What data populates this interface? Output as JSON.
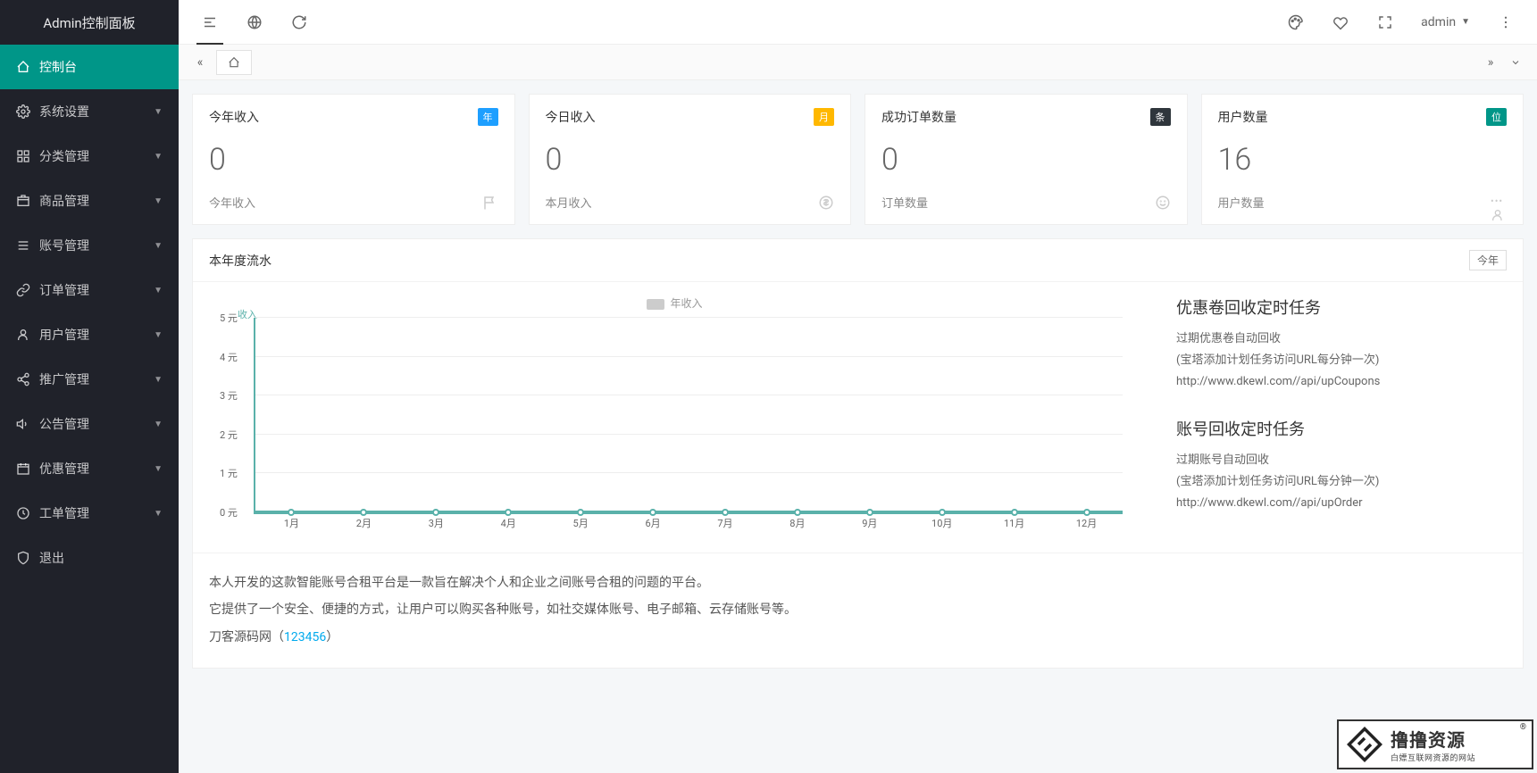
{
  "app_title": "Admin控制面板",
  "sidebar": {
    "items": [
      {
        "label": "控制台",
        "active": true,
        "arrow": false
      },
      {
        "label": "系统设置",
        "active": false,
        "arrow": true
      },
      {
        "label": "分类管理",
        "active": false,
        "arrow": true
      },
      {
        "label": "商品管理",
        "active": false,
        "arrow": true
      },
      {
        "label": "账号管理",
        "active": false,
        "arrow": true
      },
      {
        "label": "订单管理",
        "active": false,
        "arrow": true
      },
      {
        "label": "用户管理",
        "active": false,
        "arrow": true
      },
      {
        "label": "推广管理",
        "active": false,
        "arrow": true
      },
      {
        "label": "公告管理",
        "active": false,
        "arrow": true
      },
      {
        "label": "优惠管理",
        "active": false,
        "arrow": true
      },
      {
        "label": "工单管理",
        "active": false,
        "arrow": true
      },
      {
        "label": "退出",
        "active": false,
        "arrow": false
      }
    ]
  },
  "topbar": {
    "user": "admin"
  },
  "stats": [
    {
      "title": "今年收入",
      "badge": "年",
      "badge_color": "#1E9FFF",
      "value": "0",
      "footer": "今年收入",
      "icon": "flag"
    },
    {
      "title": "今日收入",
      "badge": "月",
      "badge_color": "#FFB800",
      "value": "0",
      "footer": "本月收入",
      "icon": "dollar"
    },
    {
      "title": "成功订单数量",
      "badge": "条",
      "badge_color": "#2F363C",
      "value": "0",
      "footer": "订单数量",
      "icon": "smile"
    },
    {
      "title": "用户数量",
      "badge": "位",
      "badge_color": "#009688",
      "value": "16",
      "footer": "用户数量",
      "icon": "user"
    }
  ],
  "chart_panel": {
    "title": "本年度流水",
    "tag": "今年",
    "legend": "年收入",
    "y_title": "收入"
  },
  "chart_data": {
    "type": "line",
    "categories": [
      "1月",
      "2月",
      "3月",
      "4月",
      "5月",
      "6月",
      "7月",
      "8月",
      "9月",
      "10月",
      "11月",
      "12月"
    ],
    "values": [
      0,
      0,
      0,
      0,
      0,
      0,
      0,
      0,
      0,
      0,
      0,
      0
    ],
    "ylabel": "收入",
    "xlabel": "",
    "ylim": [
      0,
      5
    ],
    "y_ticks": [
      "0 元",
      "1 元",
      "2 元",
      "3 元",
      "4 元",
      "5 元"
    ],
    "series_name": "年收入"
  },
  "tasks": {
    "coupon": {
      "title": "优惠卷回收定时任务",
      "line1": "过期优惠卷自动回收",
      "line2": "(宝塔添加计划任务访问URL每分钟一次)",
      "url": "http://www.dkewl.com//api/upCoupons"
    },
    "account": {
      "title": "账号回收定时任务",
      "line1": "过期账号自动回收",
      "line2": "(宝塔添加计划任务访问URL每分钟一次)",
      "url": "http://www.dkewl.com//api/upOrder"
    }
  },
  "description": {
    "p1": "本人开发的这款智能账号合租平台是一款旨在解决个人和企业之间账号合租的问题的平台。",
    "p2": "它提供了一个安全、便捷的方式，让用户可以购买各种账号，如社交媒体账号、电子邮箱、云存储账号等。",
    "p3_prefix": "刀客源码网（",
    "p3_link": "123456",
    "p3_suffix": "）"
  },
  "watermark": {
    "main": "撸撸资源",
    "sub": "白嫖互联网资源的网站"
  }
}
